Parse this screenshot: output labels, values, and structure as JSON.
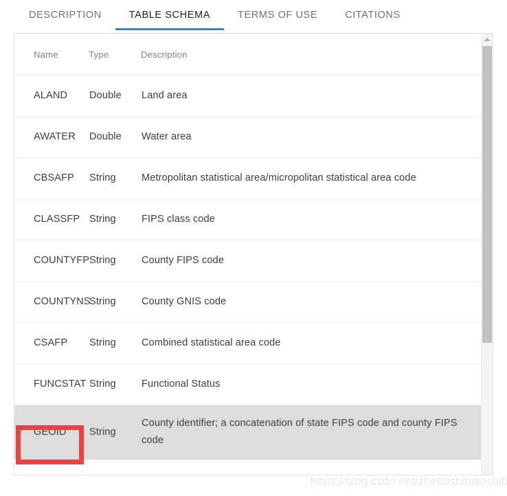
{
  "tabs": [
    {
      "label": "DESCRIPTION",
      "active": false
    },
    {
      "label": "TABLE SCHEMA",
      "active": true
    },
    {
      "label": "TERMS OF USE",
      "active": false
    },
    {
      "label": "CITATIONS",
      "active": false
    }
  ],
  "table": {
    "columns": [
      "Name",
      "Type",
      "Description"
    ],
    "rows": [
      {
        "name": "ALAND",
        "type": "Double",
        "description": "Land area",
        "highlighted": false
      },
      {
        "name": "AWATER",
        "type": "Double",
        "description": "Water area",
        "highlighted": false
      },
      {
        "name": "CBSAFP",
        "type": "String",
        "description": "Metropolitan statistical area/micropolitan statistical area code",
        "highlighted": false
      },
      {
        "name": "CLASSFP",
        "type": "String",
        "description": "FIPS class code",
        "highlighted": false
      },
      {
        "name": "COUNTYFP",
        "type": "String",
        "description": "County FIPS code",
        "highlighted": false
      },
      {
        "name": "COUNTYNS",
        "type": "String",
        "description": "County GNIS code",
        "highlighted": false
      },
      {
        "name": "CSAFP",
        "type": "String",
        "description": "Combined statistical area code",
        "highlighted": false
      },
      {
        "name": "FUNCSTAT",
        "type": "String",
        "description": "Functional Status",
        "highlighted": false
      },
      {
        "name": "GEOID",
        "type": "String",
        "description": "County identifier; a concatenation of state FIPS code and county FIPS code",
        "highlighted": true
      }
    ]
  },
  "scrollbar": {
    "up_arrow_icon": "triangle-up-icon"
  },
  "annotation": {
    "box_color": "#fa3c3c",
    "target": "GEOID"
  },
  "watermark": {
    "text": "https://blog.csdn.net/zhebushibiaoshifu"
  },
  "colors": {
    "accent": "#1a8cf0",
    "highlight_row": "#dddddd",
    "header_text": "#80868b",
    "body_text": "#3c4043"
  }
}
